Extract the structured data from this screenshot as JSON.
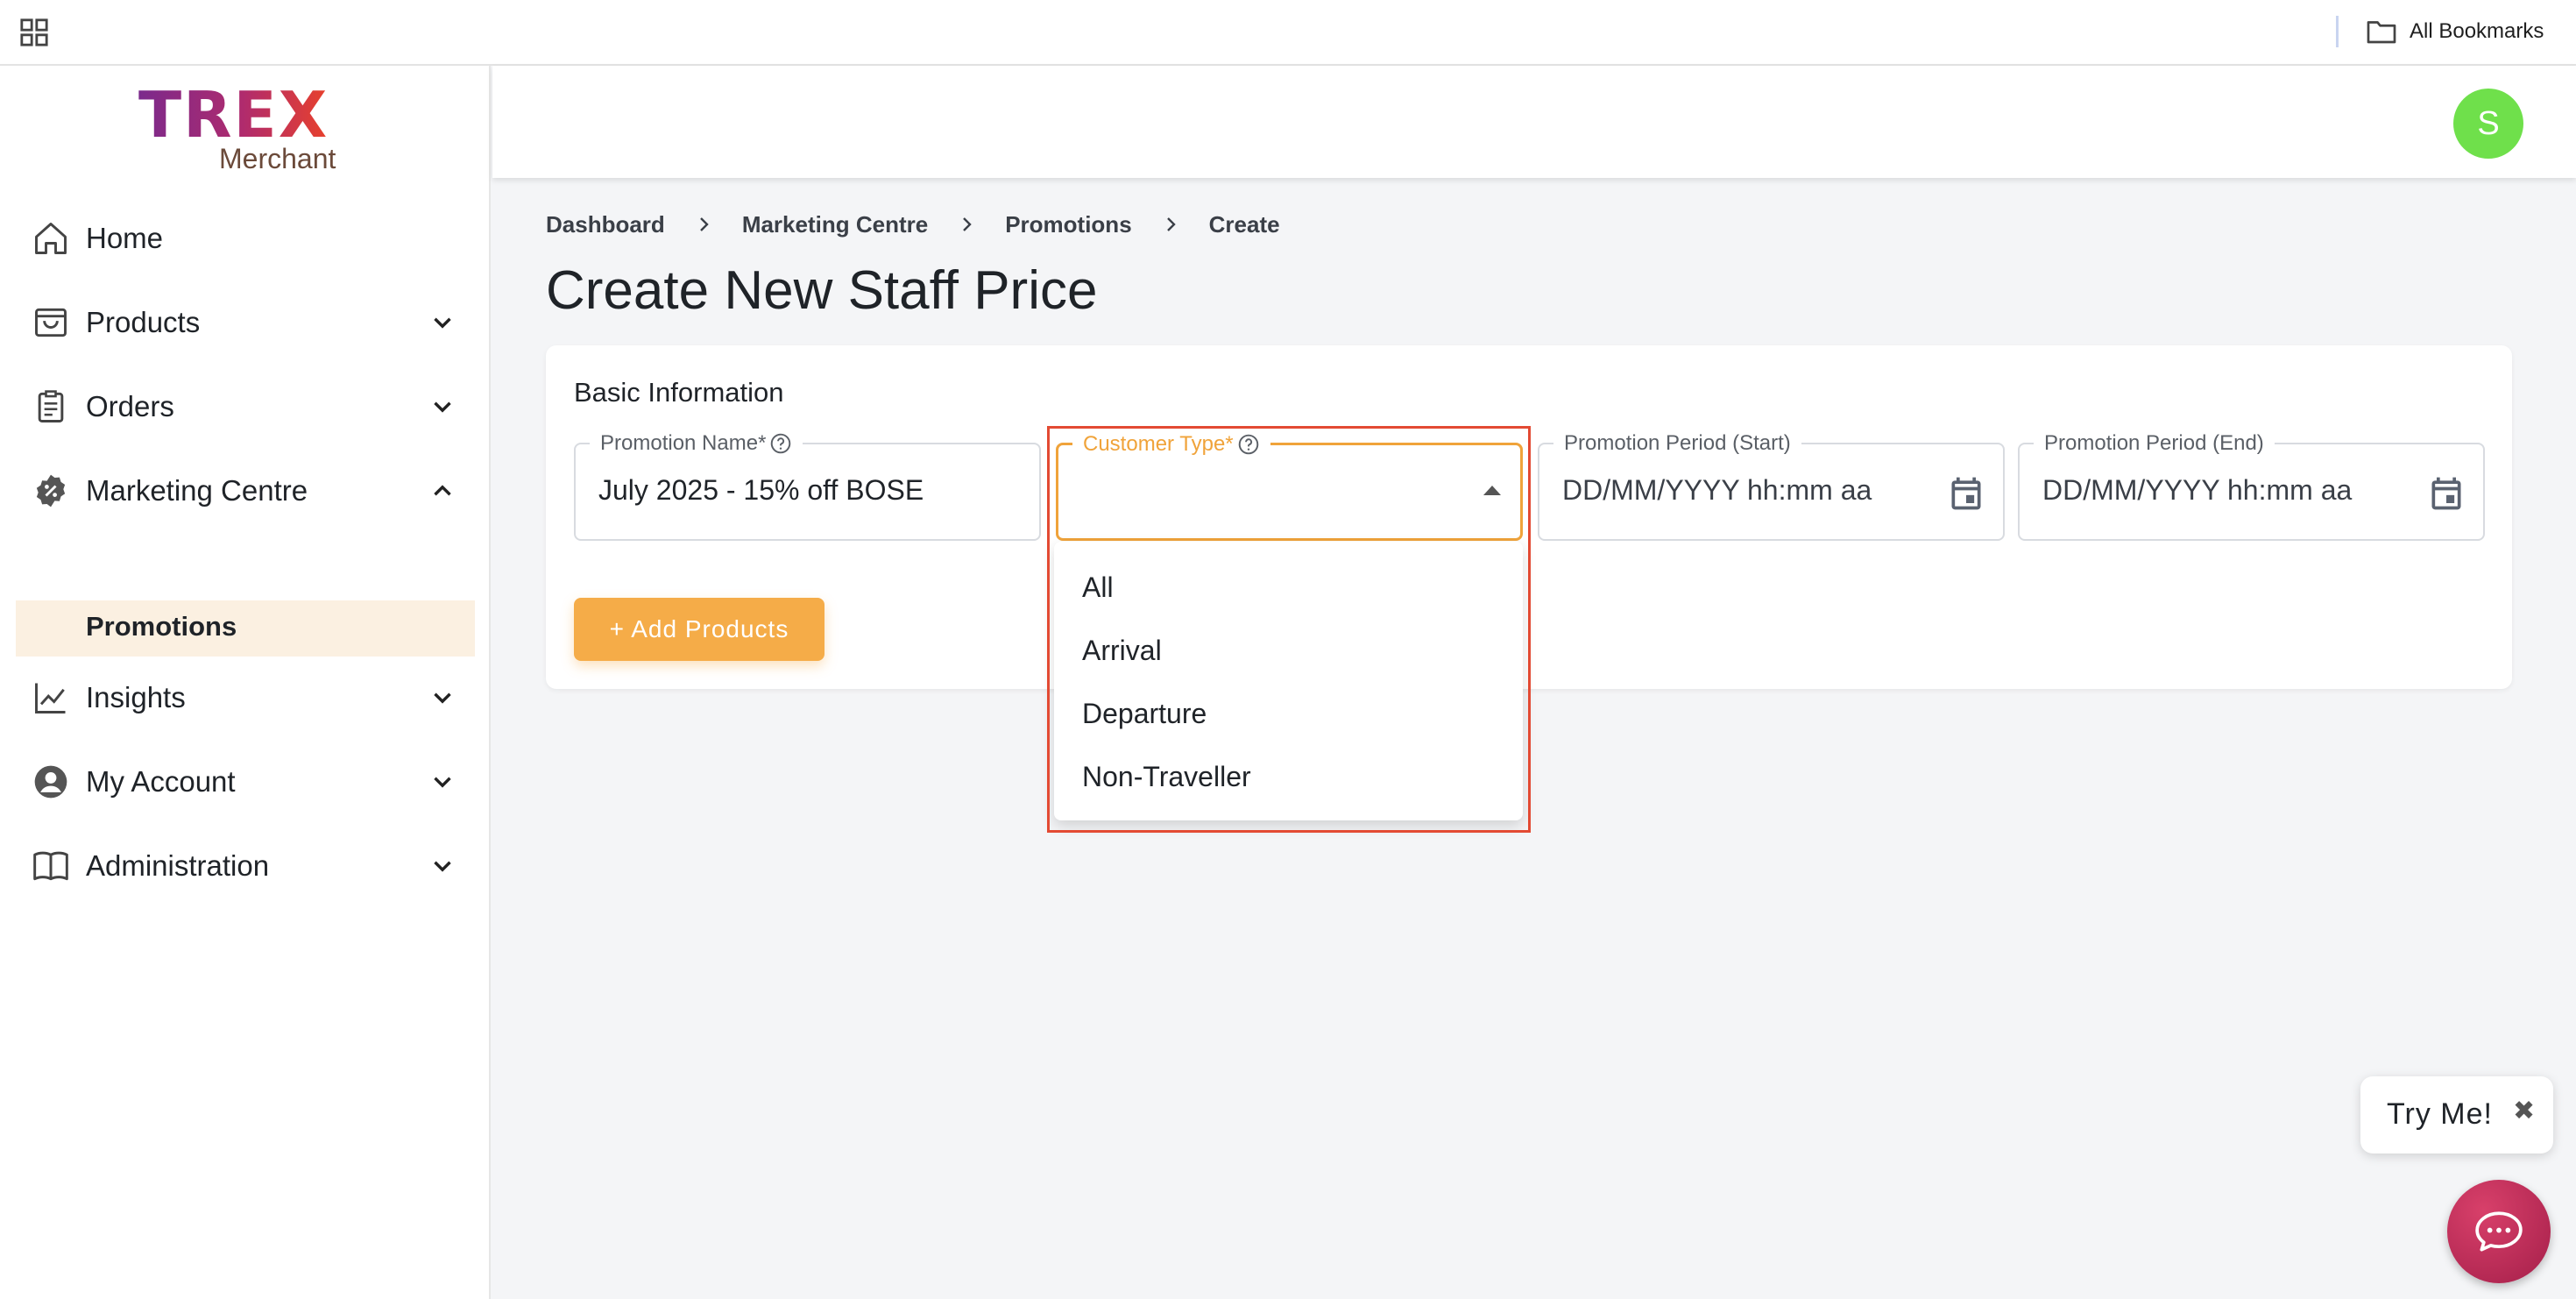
{
  "browser": {
    "bookmarks_label": "All Bookmarks"
  },
  "brand": {
    "logo_main": "TREX",
    "logo_sub": "Merchant"
  },
  "sidebar": {
    "items": [
      {
        "label": "Home",
        "icon": "home-icon"
      },
      {
        "label": "Products",
        "icon": "shopping-bag-icon"
      },
      {
        "label": "Orders",
        "icon": "clipboard-icon"
      },
      {
        "label": "Marketing Centre",
        "icon": "discount-badge-icon"
      },
      {
        "label": "Insights",
        "icon": "trend-chart-icon"
      },
      {
        "label": "My Account",
        "icon": "account-circle-icon"
      },
      {
        "label": "Administration",
        "icon": "book-icon"
      }
    ],
    "sub_item": "Promotions"
  },
  "header": {
    "avatar_initial": "S"
  },
  "breadcrumb": [
    "Dashboard",
    "Marketing Centre",
    "Promotions",
    "Create"
  ],
  "page": {
    "title": "Create New Staff Price"
  },
  "form": {
    "section_title": "Basic Information",
    "promotion_name": {
      "label": "Promotion Name*",
      "value": "July 2025 - 15% off BOSE"
    },
    "customer_type": {
      "label": "Customer Type*",
      "value": ""
    },
    "period_start": {
      "label": "Promotion Period (Start)",
      "placeholder": "DD/MM/YYYY hh:mm aa"
    },
    "period_end": {
      "label": "Promotion Period (End)",
      "placeholder": "DD/MM/YYYY hh:mm aa"
    },
    "add_products_label": "+ Add Products"
  },
  "dropdown": {
    "options": [
      "All",
      "Arrival",
      "Departure",
      "Non-Traveller"
    ]
  },
  "widget": {
    "try_me_label": "Try Me!",
    "close_glyph": "✖"
  },
  "colors": {
    "accent_orange": "#f5ac48",
    "active_field_border": "#f0a33a",
    "highlight_box": "#e34a33",
    "avatar_green": "#6fe04b",
    "sub_item_bg": "#fbf0e1"
  }
}
